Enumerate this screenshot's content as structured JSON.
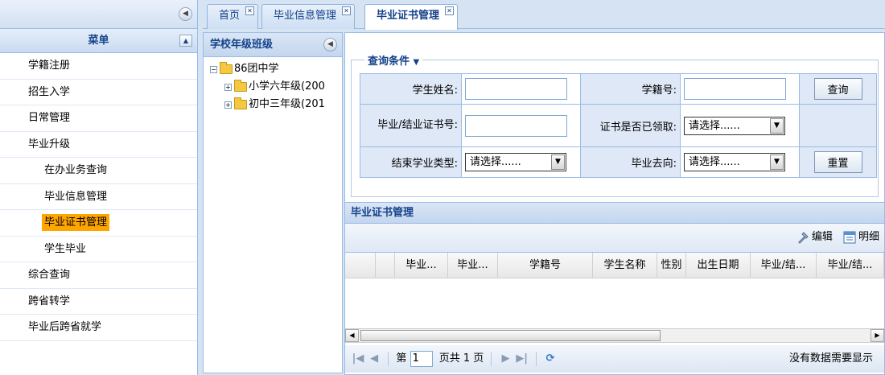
{
  "menu": {
    "header": "菜单",
    "items": [
      {
        "label": "学籍注册",
        "level": 1
      },
      {
        "label": "招生入学",
        "level": 1
      },
      {
        "label": "日常管理",
        "level": 1
      },
      {
        "label": "毕业升级",
        "level": 1
      },
      {
        "label": "在办业务查询",
        "level": 2
      },
      {
        "label": "毕业信息管理",
        "level": 2
      },
      {
        "label": "毕业证书管理",
        "level": 2,
        "active": true
      },
      {
        "label": "学生毕业",
        "level": 2
      },
      {
        "label": "综合查询",
        "level": 1
      },
      {
        "label": "跨省转学",
        "level": 1
      },
      {
        "label": "毕业后跨省就学",
        "level": 1
      }
    ]
  },
  "tabs": [
    {
      "label": "首页"
    },
    {
      "label": "毕业信息管理"
    },
    {
      "label": "毕业证书管理",
      "active": true
    }
  ],
  "tree": {
    "title": "学校年级班级",
    "root": "86团中学",
    "children": [
      "小学六年级(200",
      "初中三年级(201"
    ]
  },
  "query": {
    "legend": "查询条件",
    "student_name_label": "学生姓名:",
    "student_id_label": "学籍号:",
    "cert_no_label": "毕业/结业证书号:",
    "cert_received_label": "证书是否已领取:",
    "end_type_label": "结束学业类型:",
    "destination_label": "毕业去向:",
    "select_placeholder": "请选择......",
    "search_button": "查询",
    "reset_button": "重置"
  },
  "grid": {
    "title": "毕业证书管理",
    "edit_button": "编辑",
    "detail_button": "明细",
    "columns": [
      "毕业...",
      "毕业...",
      "学籍号",
      "学生名称",
      "性别",
      "出生日期",
      "毕业/结...",
      "毕业/结..."
    ],
    "pager": {
      "page_prefix": "第",
      "page_value": "1",
      "page_suffix": "页共 1 页",
      "status": "没有数据需要显示"
    }
  },
  "colors": {
    "header_text": "#15428b",
    "active_menu_bg": "#ffa500",
    "border": "#99bbe8"
  }
}
